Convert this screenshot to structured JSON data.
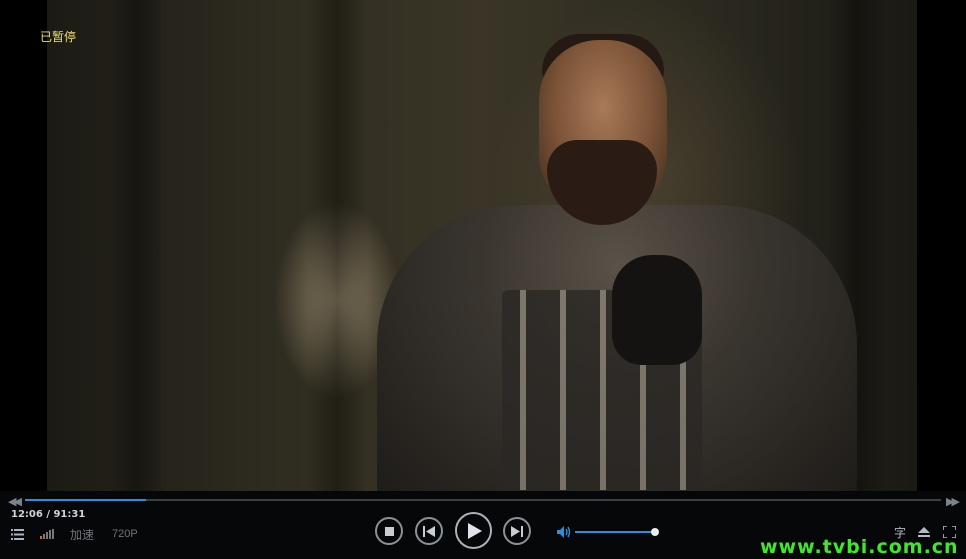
{
  "player": {
    "osd_status": "已暂停",
    "progress_fraction": 0.132,
    "time_current": "12:06",
    "time_total": "/ 91:31",
    "speed_label": "加速",
    "quality_label": "720P",
    "volume_fraction": 1.0,
    "subtitle_label": "字"
  },
  "watermark": "www.tvbi.com.cn",
  "colors": {
    "accent": "#2a8fe0",
    "osd_text": "#f0e060",
    "watermark": "#3fe82b"
  },
  "icons": [
    "playlist-icon",
    "signal-icon",
    "stop-icon",
    "previous-icon",
    "play-icon",
    "next-icon",
    "volume-icon",
    "subtitle-icon",
    "eject-icon",
    "fullscreen-icon",
    "seek-back-icon",
    "seek-forward-icon"
  ]
}
